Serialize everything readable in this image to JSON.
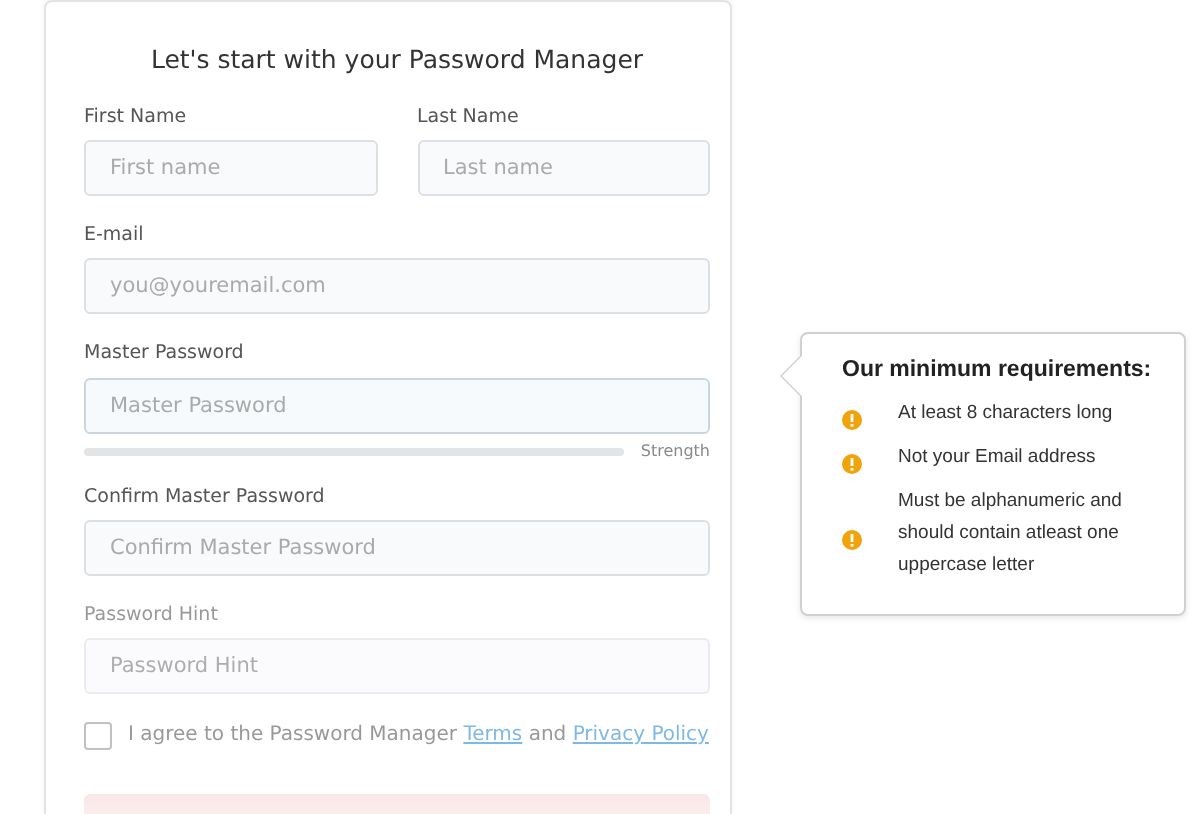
{
  "title": "Let's start with your Password Manager",
  "fields": [
    {
      "label": "First Name",
      "placeholder": "First name",
      "half": true,
      "focused": false,
      "faded": false
    },
    {
      "label": "Last Name",
      "placeholder": "Last name",
      "half": true,
      "focused": false,
      "faded": false
    },
    {
      "label": "E-mail",
      "placeholder": "you@youremail.com",
      "half": false,
      "focused": false,
      "faded": false
    },
    {
      "label": "Master Password",
      "placeholder": "Master Password",
      "half": false,
      "focused": true,
      "faded": false,
      "strength": {
        "label": "Strength",
        "level": 0
      }
    },
    {
      "label": "Confirm Master Password",
      "placeholder": "Confirm Master Password",
      "half": false,
      "focused": false,
      "faded": false
    },
    {
      "label": "Password Hint",
      "placeholder": "Password Hint",
      "half": false,
      "focused": false,
      "faded": true
    }
  ],
  "agree": {
    "checked": false,
    "text": "I agree to the Password Manager ",
    "terms": "Terms",
    "and": " and ",
    "privacy": "Privacy Policy"
  },
  "requirements": {
    "title": "Our minimum requirements:",
    "items": [
      {
        "text": "At least 8 characters long",
        "color": "#f0a30a"
      },
      {
        "text": "Not your Email address",
        "color": "#f0a30a"
      },
      {
        "text": "Must be alphanumeric and should contain atleast one uppercase letter",
        "color": "#f0a30a"
      }
    ]
  }
}
